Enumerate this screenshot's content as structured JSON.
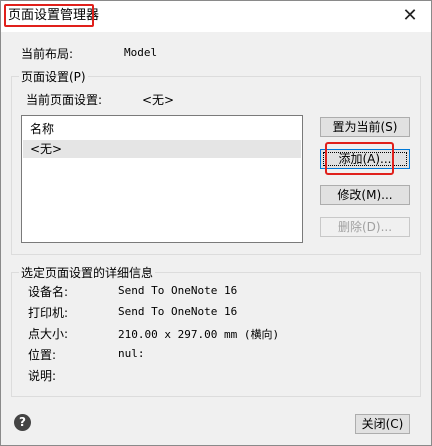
{
  "window": {
    "title": "页面设置管理器",
    "close_glyph": "✕"
  },
  "layout_info": {
    "label": "当前布局:",
    "value": "Model"
  },
  "page_setups": {
    "group_label": "页面设置(P)",
    "current_label": "当前页面设置:",
    "current_value": "<无>",
    "list_header": "名称",
    "items": [
      "<无>"
    ],
    "selected_index": 0
  },
  "buttons": {
    "set_current": "置为当前(S)",
    "add": "添加(A)...",
    "modify": "修改(M)...",
    "delete": "删除(D)..."
  },
  "details": {
    "group_label": "选定页面设置的详细信息",
    "rows": [
      {
        "label": "设备名:",
        "value": "Send To OneNote 16"
      },
      {
        "label": "打印机:",
        "value": "Send To OneNote 16"
      },
      {
        "label": "点大小:",
        "value": "210.00 x 297.00 mm (横向)"
      },
      {
        "label": "位置:",
        "value": "nul:"
      },
      {
        "label": "说明:",
        "value": ""
      }
    ]
  },
  "footer": {
    "help_glyph": "?",
    "close_button": "关闭(C)"
  },
  "colors": {
    "highlight": "#e0201b",
    "focus": "#0078d7",
    "selected_row": "#e5e5e5"
  }
}
